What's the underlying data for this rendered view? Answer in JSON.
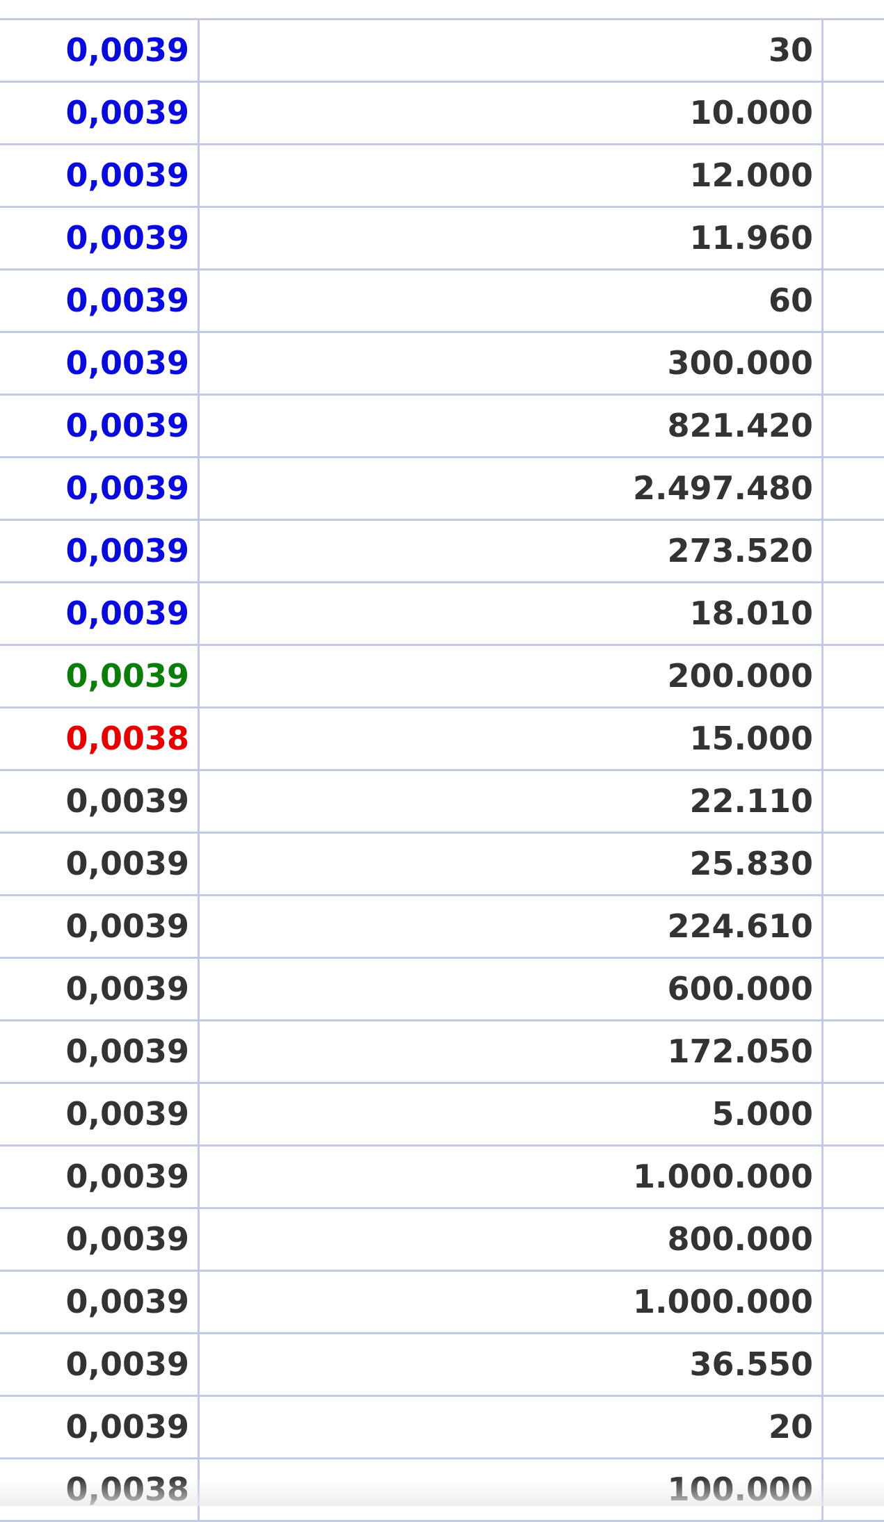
{
  "colors": {
    "blue": "#0a0adc",
    "green": "#0a7d0a",
    "red": "#e60000",
    "default": "#333333",
    "grid": "#c3cbe4"
  },
  "rows": [
    {
      "price": "0,0039",
      "qty": "30",
      "tone": "blue"
    },
    {
      "price": "0,0039",
      "qty": "10.000",
      "tone": "blue"
    },
    {
      "price": "0,0039",
      "qty": "12.000",
      "tone": "blue"
    },
    {
      "price": "0,0039",
      "qty": "11.960",
      "tone": "blue"
    },
    {
      "price": "0,0039",
      "qty": "60",
      "tone": "blue"
    },
    {
      "price": "0,0039",
      "qty": "300.000",
      "tone": "blue"
    },
    {
      "price": "0,0039",
      "qty": "821.420",
      "tone": "blue"
    },
    {
      "price": "0,0039",
      "qty": "2.497.480",
      "tone": "blue"
    },
    {
      "price": "0,0039",
      "qty": "273.520",
      "tone": "blue"
    },
    {
      "price": "0,0039",
      "qty": "18.010",
      "tone": "blue"
    },
    {
      "price": "0,0039",
      "qty": "200.000",
      "tone": "green"
    },
    {
      "price": "0,0038",
      "qty": "15.000",
      "tone": "red"
    },
    {
      "price": "0,0039",
      "qty": "22.110",
      "tone": "default"
    },
    {
      "price": "0,0039",
      "qty": "25.830",
      "tone": "default"
    },
    {
      "price": "0,0039",
      "qty": "224.610",
      "tone": "default"
    },
    {
      "price": "0,0039",
      "qty": "600.000",
      "tone": "default"
    },
    {
      "price": "0,0039",
      "qty": "172.050",
      "tone": "default"
    },
    {
      "price": "0,0039",
      "qty": "5.000",
      "tone": "default"
    },
    {
      "price": "0,0039",
      "qty": "1.000.000",
      "tone": "default"
    },
    {
      "price": "0,0039",
      "qty": "800.000",
      "tone": "default"
    },
    {
      "price": "0,0039",
      "qty": "1.000.000",
      "tone": "default"
    },
    {
      "price": "0,0039",
      "qty": "36.550",
      "tone": "default"
    },
    {
      "price": "0,0039",
      "qty": "20",
      "tone": "default"
    },
    {
      "price": "0,0038",
      "qty": "100.000",
      "tone": "default"
    }
  ]
}
